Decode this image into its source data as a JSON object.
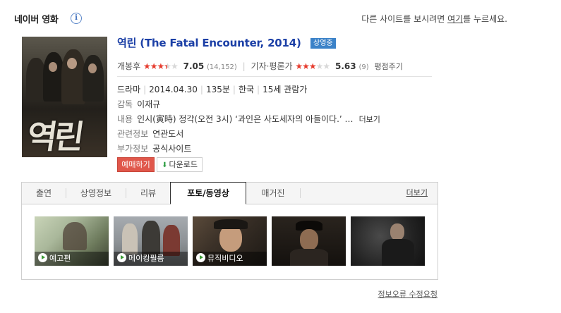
{
  "header": {
    "title": "네이버 영화",
    "info_icon": "i",
    "note_prefix": "다른 사이트를 보시려면 ",
    "note_link": "여기",
    "note_suffix": "를 누르세요."
  },
  "movie": {
    "title": "역린 (The Fatal Encounter, 2014)",
    "badge": "상영중",
    "poster_text": "역린",
    "audience": {
      "label": "개봉후",
      "rating_stars": 3.5,
      "score": "7.05",
      "count": "(14,152)"
    },
    "critics": {
      "label": "기자·평론가",
      "rating_stars": 3,
      "score": "5.63",
      "count": "(9)",
      "link": "평점주기"
    },
    "details": {
      "genre": "드라마",
      "release": "2014.04.30",
      "runtime": "135분",
      "country": "한국",
      "age": "15세 관람가"
    },
    "director": {
      "label": "감독",
      "value": "이재규"
    },
    "synopsis": {
      "label": "내용",
      "value": "인시(寅時) 정각(오전 3시) ‘과인은 사도세자의 아들이다.’ …",
      "more": "더보기"
    },
    "related": {
      "label": "관련정보",
      "value": "연관도서"
    },
    "extra": {
      "label": "부가정보",
      "value": "공식사이트"
    },
    "buttons": {
      "reserve": "예매하기",
      "download": "다운로드"
    }
  },
  "tabs": {
    "items": [
      "출연",
      "상영정보",
      "리뷰",
      "포토/동영상",
      "매거진"
    ],
    "active": "포토/동영상",
    "more": "더보기"
  },
  "thumbnails": [
    {
      "caption": "예고편",
      "icon": "play-icon"
    },
    {
      "caption": "메이킹필름",
      "icon": "play-icon"
    },
    {
      "caption": "뮤직비디오",
      "icon": "play-icon"
    },
    {
      "caption": "",
      "icon": ""
    },
    {
      "caption": "",
      "icon": ""
    }
  ],
  "footer": {
    "link": "정보오류 수정요청"
  },
  "colors": {
    "title_blue": "#1b3fa6",
    "badge_blue": "#3b82c8",
    "star_red": "#e63b2d",
    "reserve_red": "#e0574b",
    "play_green": "#3a9a33"
  }
}
